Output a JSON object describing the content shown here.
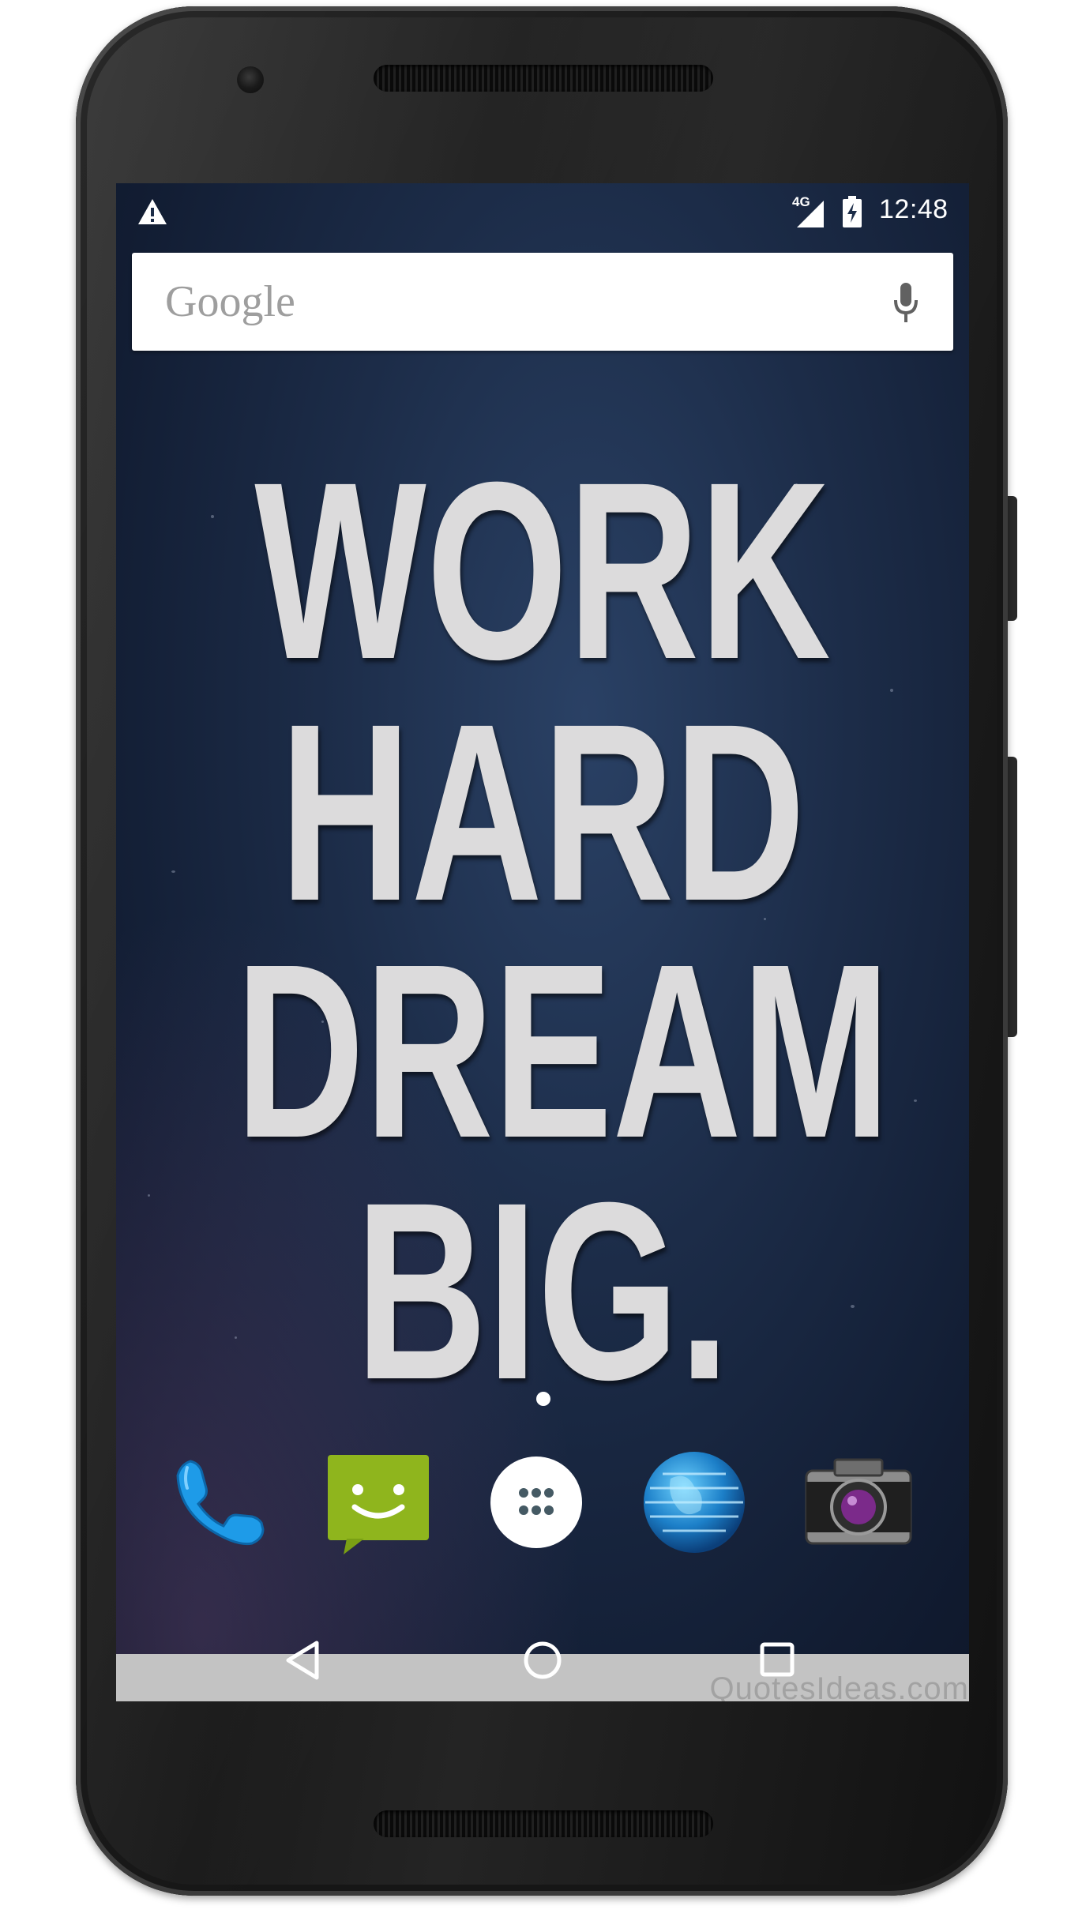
{
  "status_bar": {
    "warning_icon": "warning-triangle-icon",
    "network_type": "4G",
    "signal_icon": "cellular-signal-icon",
    "battery_icon": "battery-charging-icon",
    "time": "12:48"
  },
  "search_bar": {
    "logo": "Google",
    "mic_icon": "microphone-icon"
  },
  "wallpaper": {
    "quote_lines": [
      "WORK",
      "HARD",
      "DREAM",
      "BIG."
    ],
    "background_color": "#1c2c48",
    "text_color": "#dcdbdc"
  },
  "dock": {
    "apps": [
      {
        "icon": "phone-icon"
      },
      {
        "icon": "messaging-icon"
      },
      {
        "icon": "app-drawer-icon"
      },
      {
        "icon": "browser-globe-icon"
      },
      {
        "icon": "camera-icon"
      }
    ]
  },
  "nav_bar": {
    "back_icon": "back-triangle-icon",
    "home_icon": "home-circle-icon",
    "recents_icon": "recents-square-icon"
  },
  "watermark": "QuotesIdeas.com"
}
